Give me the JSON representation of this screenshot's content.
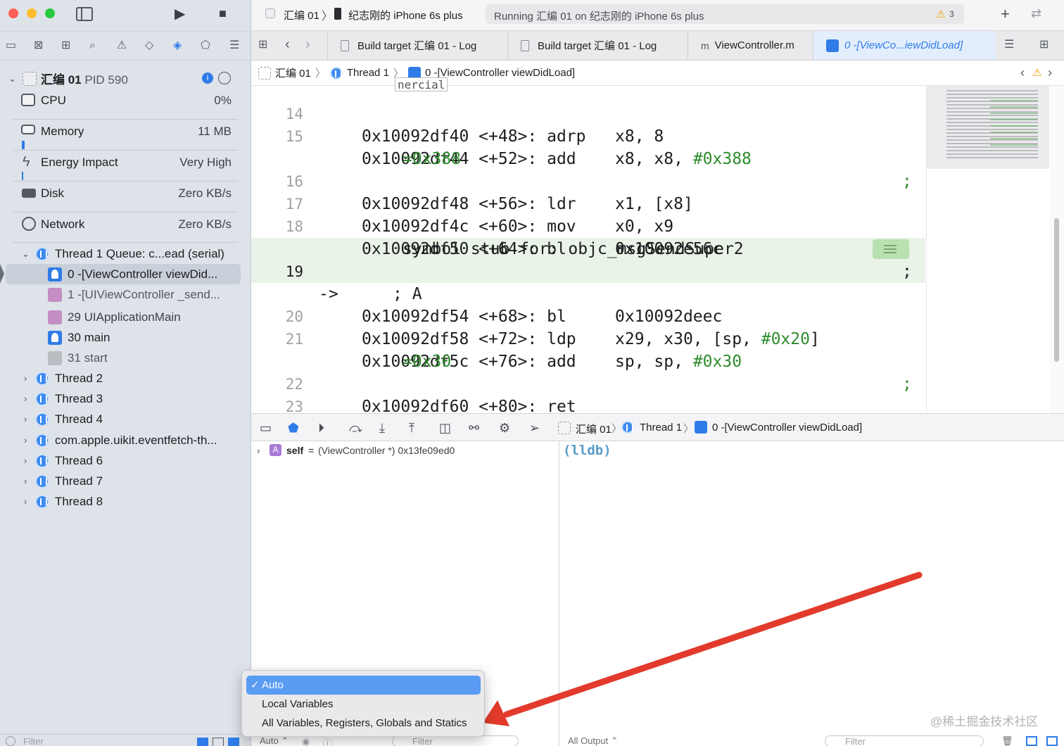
{
  "toolbar": {
    "scheme": "汇编 01",
    "device": "纪志刚的 iPhone 6s plus",
    "status": "Running 汇编 01 on 纪志刚的 iPhone 6s plus",
    "warning_count": "3"
  },
  "navigator": {
    "process": {
      "name": "汇编 01",
      "pid": "PID 590"
    },
    "gauges": [
      {
        "label": "CPU",
        "value": "0%"
      },
      {
        "label": "Memory",
        "value": "11 MB"
      },
      {
        "label": "Energy Impact",
        "value": "Very High"
      },
      {
        "label": "Disk",
        "value": "Zero KB/s"
      },
      {
        "label": "Network",
        "value": "Zero KB/s"
      }
    ],
    "thread1": "Thread 1 Queue: c...ead (serial)",
    "frames": [
      "0 -[ViewController viewDid...",
      "1 -[UIViewController _send...",
      "29 UIApplicationMain",
      "30 main",
      "31 start"
    ],
    "threads": [
      "Thread 2",
      "Thread 3",
      "Thread 4",
      "com.apple.uikit.eventfetch-th...",
      "Thread 6",
      "Thread 7",
      "Thread 8"
    ],
    "filter_placeholder": "Filter"
  },
  "tabs": [
    "Build target 汇编 01 - Log",
    "Build target 汇编 01 - Log",
    "ViewController.m",
    "0 -[ViewCo...iewDidLoad]"
  ],
  "jumpbar": {
    "project": "汇编 01",
    "thread": "Thread 1",
    "frame": "0 -[ViewController viewDidLoad]",
    "tooltip": "nercial"
  },
  "code": {
    "l14": {
      "n": "14",
      "text": "0x10092df40 <+48>: adrp   x8, 8"
    },
    "l15": {
      "n": "15",
      "text": "0x10092df44 <+52>: add    x8, x8, ",
      "imm": "#0x388",
      "semi": ";",
      "cont": "=0x388"
    },
    "l16": {
      "n": "16",
      "text": "0x10092df48 <+56>: ldr    x1, [x8]"
    },
    "l17": {
      "n": "17",
      "text": "0x10092df4c <+60>: mov    x0, x9"
    },
    "l18": {
      "n": "18",
      "text": "0x10092df50 <+64>: bl     0x10092e56c",
      "semi": ";",
      "cont": "symbol stub for: objc_msgSendSuper2"
    },
    "l19": {
      "n": "19",
      "arrow": "->",
      "text": "0x10092df54 <+68>: bl     0x10092deec",
      "cont": "; A"
    },
    "l20": {
      "n": "20",
      "text": "0x10092df58 <+72>: ldp    x29, x30, [sp, ",
      "imm": "#0x20",
      "tail": "]"
    },
    "l21": {
      "n": "21",
      "text": "0x10092df5c <+76>: add    sp, sp, ",
      "imm": "#0x30",
      "semi": ";",
      "cont": "=0x30"
    },
    "l22": {
      "n": "22",
      "text": "0x10092df60 <+80>: ret"
    },
    "l23": {
      "n": "23"
    }
  },
  "debugbar": {
    "project": "汇编 01",
    "thread": "Thread 1",
    "frame": "0 -[ViewController viewDidLoad]"
  },
  "variables": {
    "name": "self",
    "eq": "=",
    "value": "(ViewController *) 0x13fe09ed0"
  },
  "console": {
    "prompt": "(lldb)"
  },
  "bottom": {
    "scope": "Auto ⌃",
    "filter": "Filter",
    "output": "All Output ⌃",
    "console_filter": "Filter"
  },
  "menu": {
    "items": [
      "Auto",
      "Local Variables",
      "All Variables, Registers, Globals and Statics"
    ],
    "check": "✓"
  },
  "watermark": "@稀土掘金技术社区",
  "colors": {
    "accent": "#2f7ce8",
    "arrow": "#e23a2b",
    "current_line": "#e9f3e7",
    "number": "#2d8c2d"
  }
}
